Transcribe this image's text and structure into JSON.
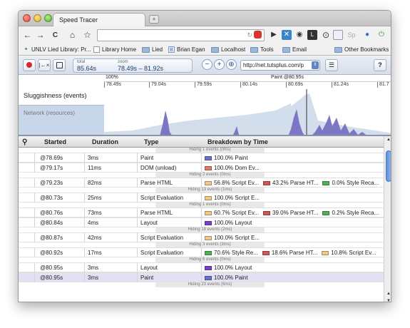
{
  "window": {
    "tab_title": "Speed Tracer",
    "new_tab": "+"
  },
  "toolbar": {
    "back": "←",
    "forward": "→",
    "reload": "C",
    "home": "⌂",
    "star": "☆",
    "omnibox_value": ""
  },
  "bookmarks": [
    {
      "label": "UNLV Lied Library: Pr...",
      "icon": "lied-icon"
    },
    {
      "label": "Library Home",
      "icon": "page-icon"
    },
    {
      "label": "Lied",
      "icon": "folder-icon"
    },
    {
      "label": "Brian Egan",
      "icon": "b-icon"
    },
    {
      "label": "Localhost",
      "icon": "folder-icon"
    },
    {
      "label": "Tools",
      "icon": "folder-icon"
    },
    {
      "label": "Email",
      "icon": "folder-icon"
    },
    {
      "label": "Other Bookmarks",
      "icon": "folder-icon"
    }
  ],
  "speed_tracer": {
    "total_label": "total",
    "total_value": "85.64s",
    "zoom_label": "zoom",
    "zoom_value": "78.49s – 81.92s",
    "url": "http://net.tutsplus.com/p",
    "help": "?"
  },
  "timeline": {
    "ruler_pct": "100%",
    "marker_label": "Paint @80.95s",
    "ticks": [
      "78.49s",
      "79.04s",
      "79.59s",
      "80.14s",
      "80.69s",
      "81.24s",
      "81.7"
    ],
    "sluggishness_label": "Sluggishness (events)",
    "network_label": "Network (resources)"
  },
  "table": {
    "headers": {
      "started": "Started",
      "duration": "Duration",
      "type": "Type",
      "breakdown": "Breakdown by Time"
    },
    "rows": [
      {
        "kind": "hidden",
        "text": "Hiding 1 events (0ms)"
      },
      {
        "kind": "event",
        "started": "@78.69s",
        "duration": "3ms",
        "type": "Paint",
        "breakdown": [
          {
            "color": "#6b72c8",
            "text": "100.0% Paint"
          }
        ]
      },
      {
        "kind": "event",
        "started": "@79.17s",
        "duration": "11ms",
        "type": "DOM (unload)",
        "breakdown": [
          {
            "color": "#e07a60",
            "text": "100.0% Dom Ev..."
          }
        ]
      },
      {
        "kind": "hidden",
        "text": "Hiding 2 events (0ms)"
      },
      {
        "kind": "event",
        "started": "@79.23s",
        "duration": "82ms",
        "type": "Parse HTML",
        "breakdown": [
          {
            "color": "#f0c98a",
            "text": "56.8% Script Ev..."
          },
          {
            "color": "#c85a5a",
            "text": "43.2% Parse HT..."
          },
          {
            "color": "#55b055",
            "text": "0.0% Style Reca..."
          }
        ]
      },
      {
        "kind": "hidden",
        "text": "Hiding 13 events (1ms)"
      },
      {
        "kind": "event",
        "started": "@80.73s",
        "duration": "25ms",
        "type": "Script Evaluation",
        "breakdown": [
          {
            "color": "#f0c98a",
            "text": "100.0% Script E..."
          }
        ]
      },
      {
        "kind": "hidden",
        "text": "Hiding 1 events (0ms)"
      },
      {
        "kind": "event",
        "started": "@80.76s",
        "duration": "73ms",
        "type": "Parse HTML",
        "breakdown": [
          {
            "color": "#f0c98a",
            "text": "60.7% Script Ev..."
          },
          {
            "color": "#c85a5a",
            "text": "39.0% Parse HT..."
          },
          {
            "color": "#55b055",
            "text": "0.2% Style Reca..."
          }
        ]
      },
      {
        "kind": "event",
        "started": "@80.84s",
        "duration": "4ms",
        "type": "Layout",
        "breakdown": [
          {
            "color": "#7b3fd0",
            "text": "100.0% Layout"
          }
        ]
      },
      {
        "kind": "hidden",
        "text": "Hiding 18 events (2ms)"
      },
      {
        "kind": "event",
        "started": "@80.87s",
        "duration": "42ms",
        "type": "Script Evaluation",
        "breakdown": [
          {
            "color": "#f0c98a",
            "text": "100.0% Script E..."
          }
        ]
      },
      {
        "kind": "hidden",
        "text": "Hiding 3 events (3ms)"
      },
      {
        "kind": "event",
        "started": "@80.92s",
        "duration": "17ms",
        "type": "Script Evaluation",
        "breakdown": [
          {
            "color": "#55b055",
            "text": "70.6% Style Re..."
          },
          {
            "color": "#c85a5a",
            "text": "18.6% Parse HT..."
          },
          {
            "color": "#f0c98a",
            "text": "10.8% Script Ev..."
          }
        ]
      },
      {
        "kind": "hidden",
        "text": "Hiding 6 events (0ms)"
      },
      {
        "kind": "event",
        "started": "@80.95s",
        "duration": "3ms",
        "type": "Layout",
        "breakdown": [
          {
            "color": "#7b3fd0",
            "text": "100.0% Layout"
          }
        ]
      },
      {
        "kind": "event",
        "started": "@80.95s",
        "duration": "3ms",
        "type": "Paint",
        "selected": true,
        "breakdown": [
          {
            "color": "#6b72c8",
            "text": "100.0% Paint"
          }
        ]
      },
      {
        "kind": "hidden",
        "text": "Hiding 23 events (6ms)"
      }
    ]
  },
  "colors": {
    "graph_fill": "#c8d6ea",
    "spike_fill": "#7d76c4",
    "accent": "#5d86c9"
  }
}
